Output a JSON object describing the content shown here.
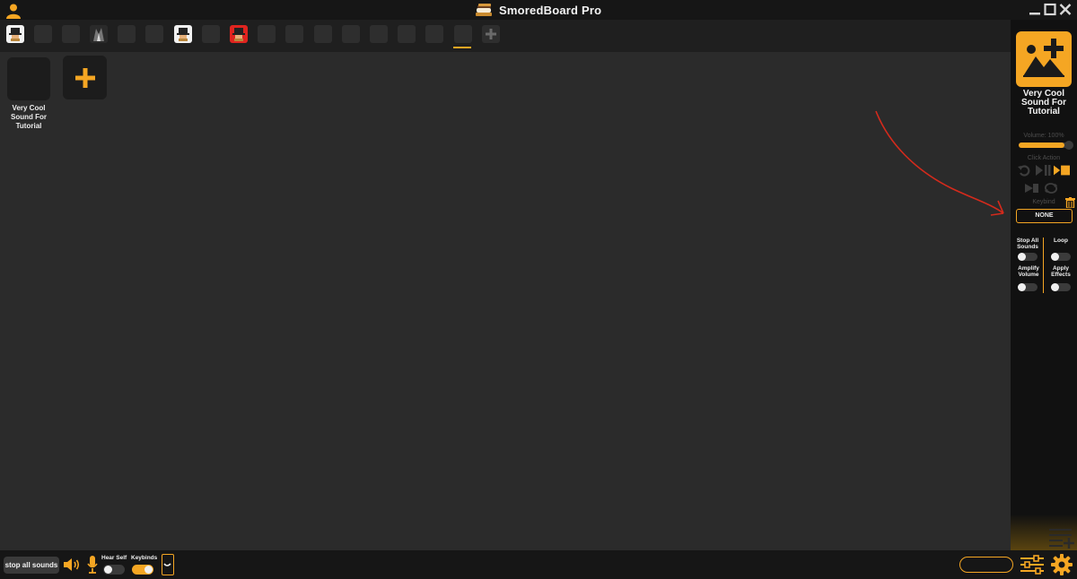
{
  "app": {
    "title": "SmoredBoard Pro",
    "accent_color": "#f5a623"
  },
  "titlebar": {
    "user_icon": "user-icon",
    "controls": [
      "minimize",
      "maximize",
      "close"
    ]
  },
  "tabs": {
    "count": 17,
    "active_index": 16,
    "items": [
      {
        "icon": "hat-avatar"
      },
      {
        "icon": "empty"
      },
      {
        "icon": "empty"
      },
      {
        "icon": "dark-figure"
      },
      {
        "icon": "empty"
      },
      {
        "icon": "empty"
      },
      {
        "icon": "hat-avatar"
      },
      {
        "icon": "empty"
      },
      {
        "icon": "red-hat-avatar"
      },
      {
        "icon": "empty"
      },
      {
        "icon": "empty"
      },
      {
        "icon": "empty"
      },
      {
        "icon": "empty"
      },
      {
        "icon": "empty"
      },
      {
        "icon": "empty"
      },
      {
        "icon": "empty"
      },
      {
        "icon": "empty"
      }
    ]
  },
  "board": {
    "sounds": [
      {
        "label": "Very Cool Sound For Tutorial"
      }
    ]
  },
  "sidebar": {
    "sound_title": "Very Cool Sound For Tutorial",
    "volume_label": "Volume: 100%",
    "volume_fraction": 0.85,
    "click_action_label": "Click Action",
    "keybind_label": "Keybind",
    "keybind_value": "NONE",
    "options": {
      "stop_all_sounds": {
        "label": "Stop All Sounds",
        "on": false
      },
      "loop": {
        "label": "Loop",
        "on": false
      },
      "amplify_volume": {
        "label": "Amplify Volume",
        "on": false
      },
      "apply_effects": {
        "label": "Apply Effects",
        "on": false
      }
    }
  },
  "bottombar": {
    "stop_all_label": "stop all sounds",
    "hear_self_label": "Hear Self",
    "hear_self_on": false,
    "keybinds_label": "Keybinds",
    "keybinds_on": true,
    "search_value": ""
  }
}
